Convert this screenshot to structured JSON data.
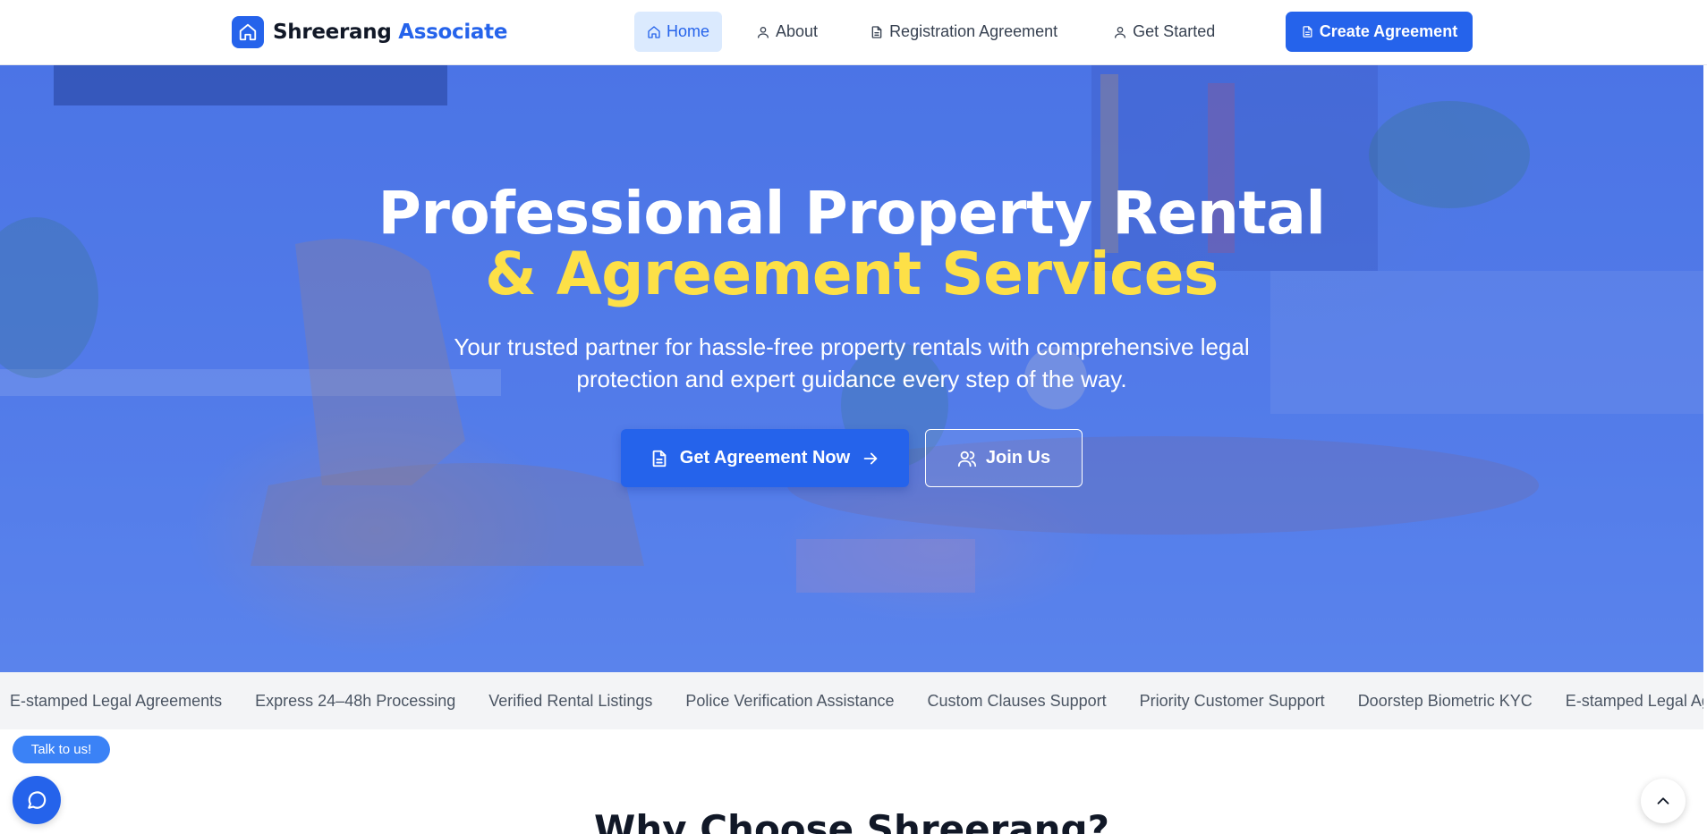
{
  "brand": {
    "name_part1": "Shreerang",
    "name_part2": "Associate",
    "logo_icon": "home-icon",
    "accent_color": "#2563eb"
  },
  "nav": {
    "items": [
      {
        "label": "Home",
        "icon": "home-icon",
        "active": true
      },
      {
        "label": "About",
        "icon": "user-icon",
        "active": false
      },
      {
        "label": "Registration Agreement",
        "icon": "document-icon",
        "active": false
      },
      {
        "label": "Get Started",
        "icon": "user-icon",
        "active": false
      }
    ],
    "cta_label": "Create Agreement"
  },
  "hero": {
    "title_line1": "Professional Property Rental",
    "title_line2": "& Agreement Services",
    "subtitle": "Your trusted partner for hassle-free property rentals with comprehensive legal protection and expert guidance every step of the way.",
    "primary_button": "Get Agreement Now",
    "secondary_button": "Join Us",
    "highlight_color": "#fde047"
  },
  "ticker": {
    "items": [
      "E-stamped Legal Agreements",
      "Express 24–48h Processing",
      "Verified Rental Listings",
      "Police Verification Assistance",
      "Custom Clauses Support",
      "Priority Customer Support",
      "Doorstep Biometric KYC",
      "E-stamped Legal Agreements"
    ]
  },
  "chat": {
    "pill_label": "Talk to us!",
    "button_icon": "chat-bubble-icon"
  },
  "scroll_top_icon": "chevron-up-icon",
  "section": {
    "title": "Why Choose Shreerang?"
  }
}
